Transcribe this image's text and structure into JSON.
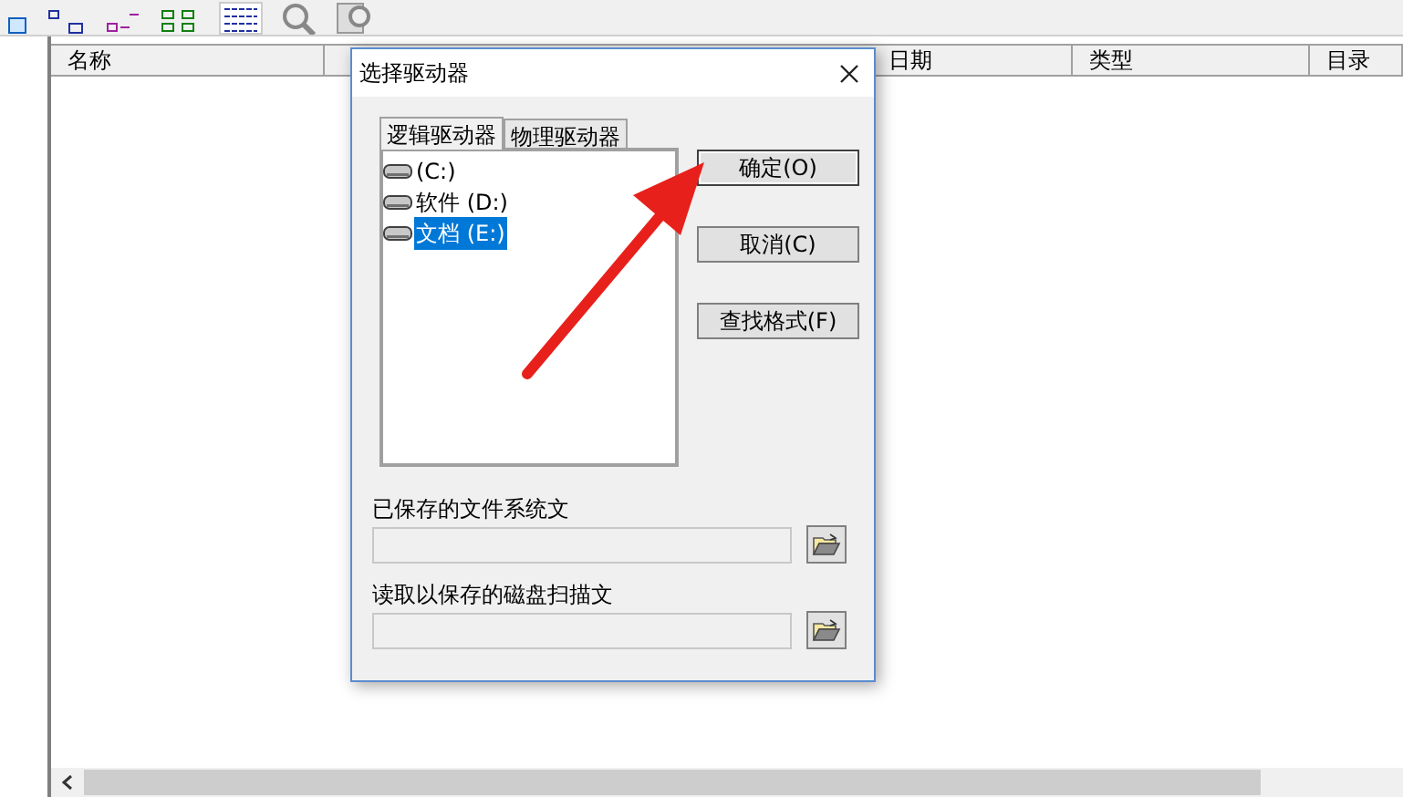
{
  "list": {
    "columns": [
      "名称",
      "日期",
      "类型",
      "目录"
    ]
  },
  "dialog": {
    "title": "选择驱动器",
    "tabs": [
      {
        "label": "逻辑驱动器",
        "selected": true
      },
      {
        "label": "物理驱动器",
        "selected": false
      }
    ],
    "drives": [
      {
        "label": "(C:)",
        "selected": false
      },
      {
        "label": "软件 (D:)",
        "selected": false
      },
      {
        "label": "文档 (E:)",
        "selected": true
      }
    ],
    "buttons": [
      "确定(O)",
      "取消(C)",
      "查找格式(F)"
    ],
    "fields": [
      {
        "label": "已保存的文件系统文"
      },
      {
        "label": "读取以保存的磁盘扫描文"
      }
    ]
  }
}
